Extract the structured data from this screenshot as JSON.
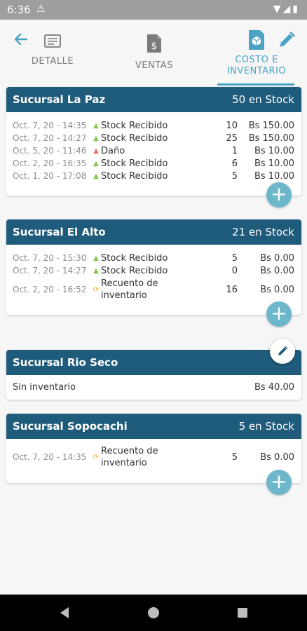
{
  "status_bar": {
    "time": "6:36"
  },
  "tabs": [
    {
      "label": "DETALLE",
      "icon": "document-icon"
    },
    {
      "label": "VENTAS",
      "icon": "invoice-dollar-icon"
    },
    {
      "label": "COSTO E INVENTARIO",
      "icon": "inventory-box-icon"
    }
  ],
  "branches": [
    {
      "name": "Sucursal La Paz",
      "stock": "50 en Stock",
      "rows": [
        {
          "date": "Oct. 7, 20 - 14:35",
          "type": "Stock Recibido",
          "qty": "10",
          "amount": "Bs 150.00"
        },
        {
          "date": "Oct. 7, 20 - 14:27",
          "type": "Stock Recibido",
          "qty": "25",
          "amount": "Bs 150.00"
        },
        {
          "date": "Oct. 5, 20 - 11:46",
          "type": "Daño",
          "qty": "1",
          "amount": "Bs 10.00"
        },
        {
          "date": "Oct. 2, 20 - 16:35",
          "type": "Stock Recibido",
          "qty": "6",
          "amount": "Bs 10.00"
        },
        {
          "date": "Oct. 1, 20 - 17:08",
          "type": "Stock Recibido",
          "qty": "5",
          "amount": "Bs 10.00"
        }
      ]
    },
    {
      "name": "Sucursal El Alto",
      "stock": "21 en Stock",
      "rows": [
        {
          "date": "Oct. 7, 20 - 15:30",
          "type": "Stock Recibido",
          "qty": "5",
          "amount": "Bs 0.00"
        },
        {
          "date": "Oct. 7, 20 - 14:27",
          "type": "Stock Recibido",
          "qty": "0",
          "amount": "Bs 0.00"
        },
        {
          "date": "Oct. 2, 20 - 16:52",
          "type": "Recuento de inventario",
          "qty": "16",
          "amount": "Bs 0.00"
        }
      ]
    },
    {
      "name": "Sucursal Rio Seco",
      "stock": "",
      "empty_label": "Sin inventario",
      "empty_amount": "Bs 40.00"
    },
    {
      "name": "Sucursal Sopocachi",
      "stock": "5 en Stock",
      "rows": [
        {
          "date": "Oct. 7, 20 - 14:35",
          "type": "Recuento de inventario",
          "qty": "5",
          "amount": "Bs 0.00"
        }
      ]
    }
  ],
  "colors": {
    "accent": "#4aa3c4",
    "header": "#1f5b7a",
    "fab": "#6cb7c9"
  }
}
